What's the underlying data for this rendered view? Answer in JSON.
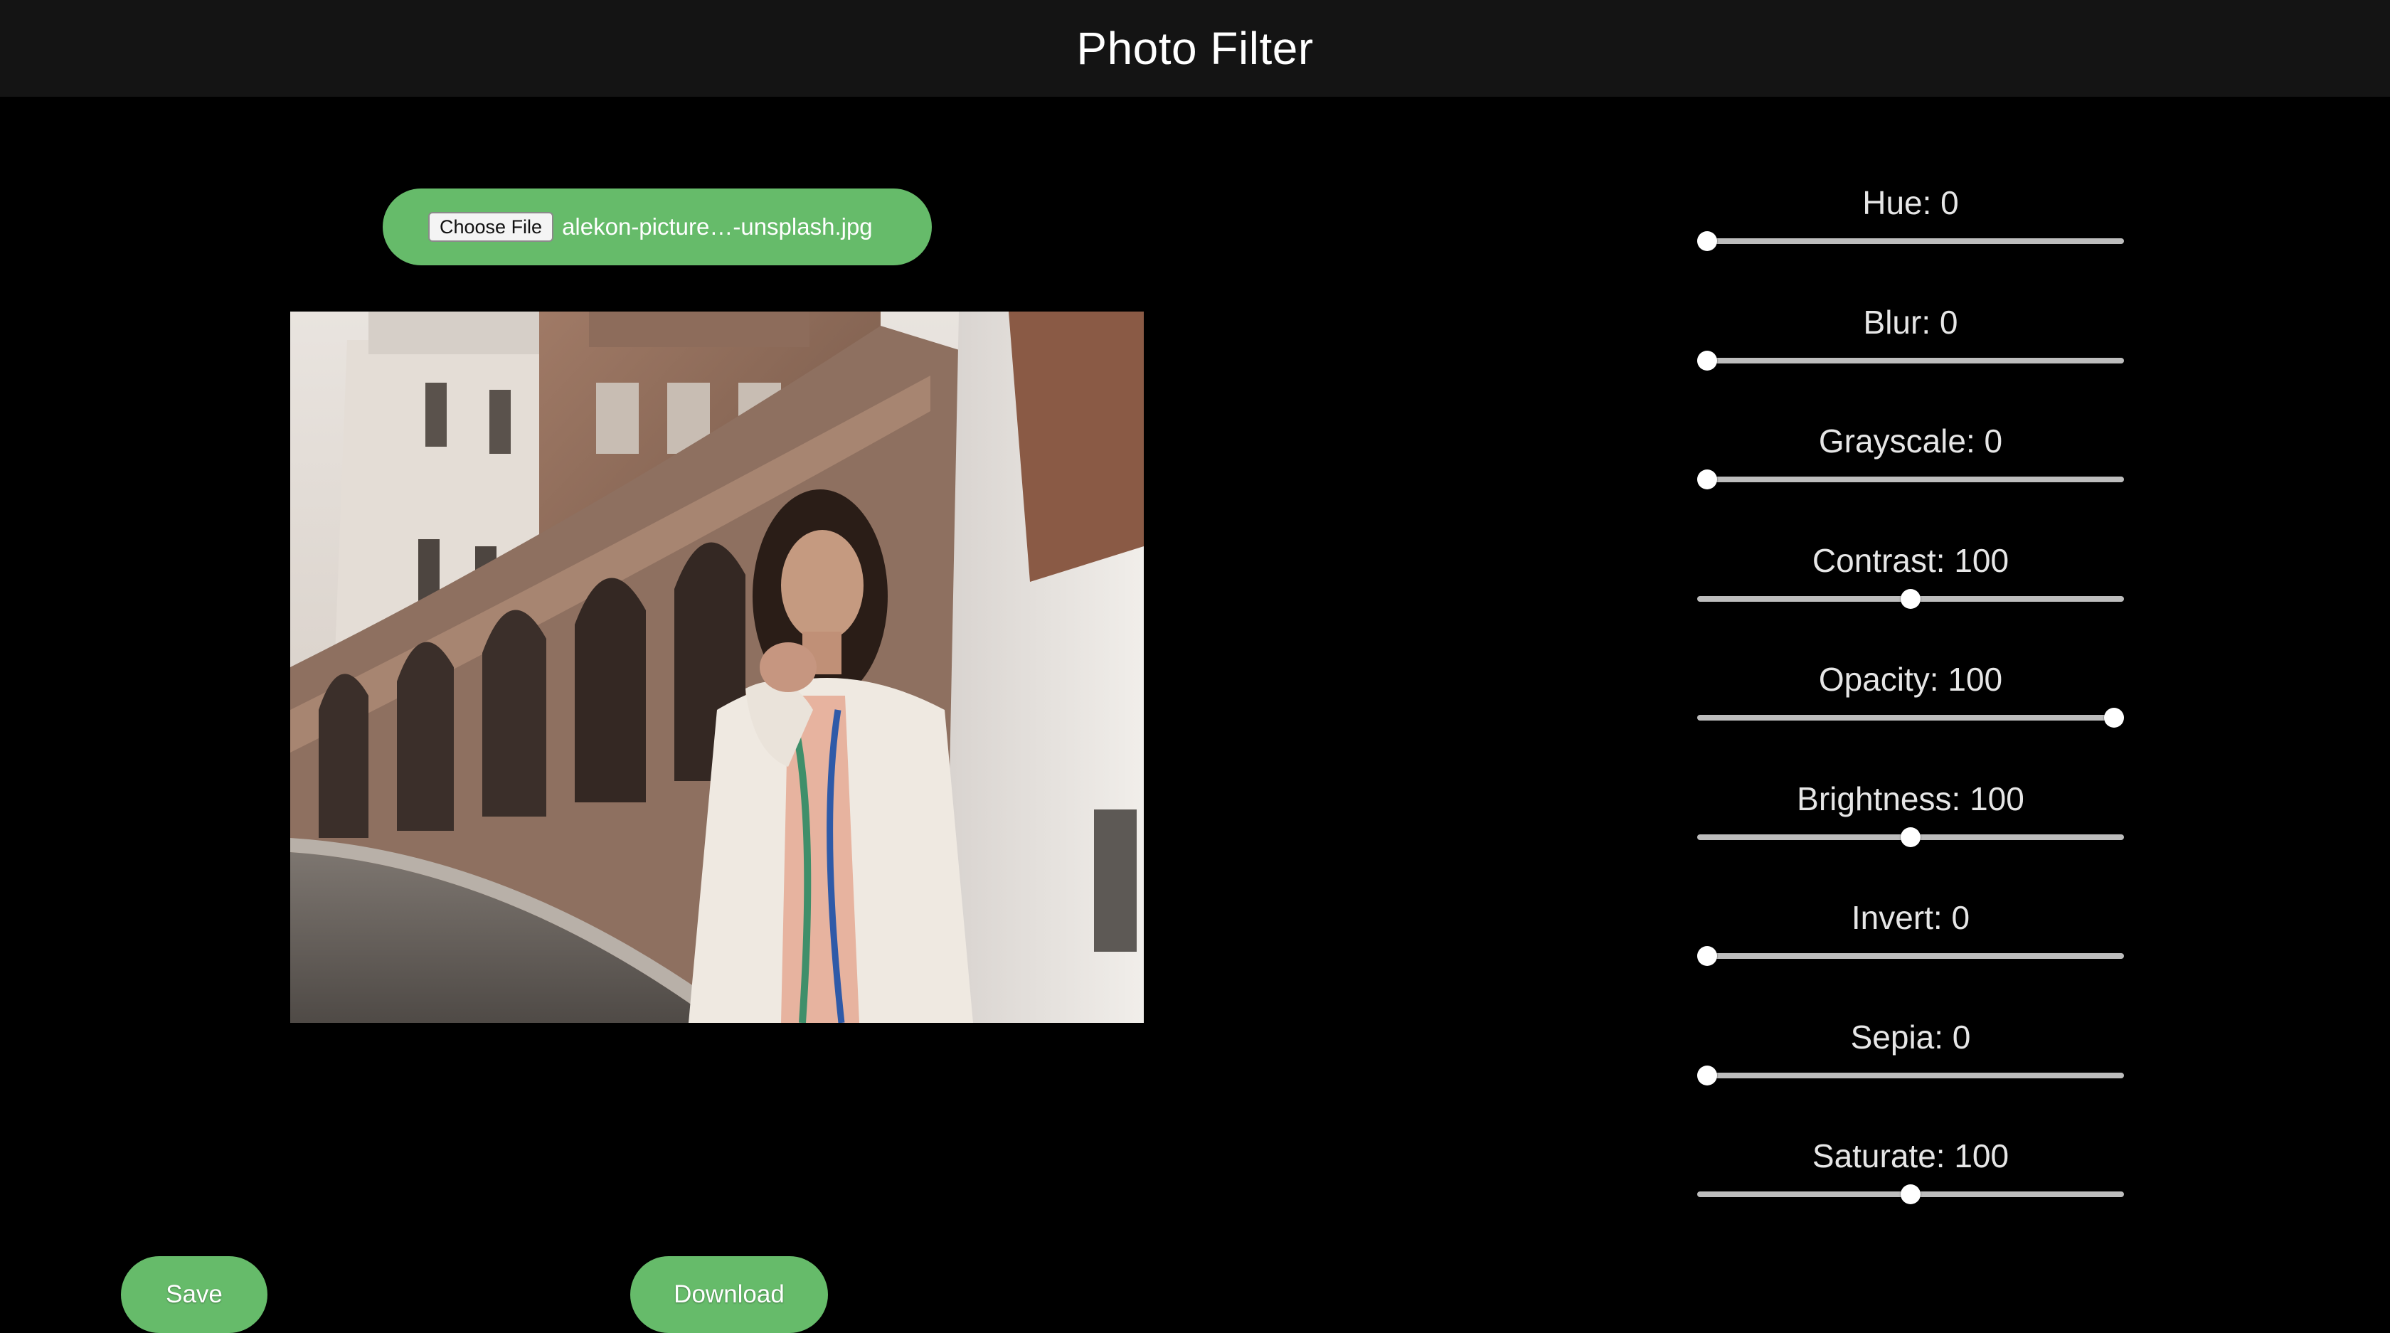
{
  "header": {
    "title": "Photo Filter"
  },
  "file_input": {
    "button_label": "Choose File",
    "file_name": "alekon-picture…-unsplash.jpg"
  },
  "image": {
    "alt": ""
  },
  "filters": [
    {
      "label": "Hue: 0",
      "fraction": 0.0
    },
    {
      "label": "Blur: 0",
      "fraction": 0.0
    },
    {
      "label": "Grayscale: 0",
      "fraction": 0.0
    },
    {
      "label": "Contrast: 100",
      "fraction": 0.5
    },
    {
      "label": "Opacity: 100",
      "fraction": 1.0
    },
    {
      "label": "Brightness: 100",
      "fraction": 0.5
    },
    {
      "label": "Invert: 0",
      "fraction": 0.0
    },
    {
      "label": "Sepia: 0",
      "fraction": 0.0
    },
    {
      "label": "Saturate: 100",
      "fraction": 0.5
    }
  ],
  "actions": {
    "save_label": "Save",
    "download_label": "Download"
  },
  "colors": {
    "accent": "#66bb6a",
    "header_bg": "#141414",
    "page_bg": "#000000"
  }
}
